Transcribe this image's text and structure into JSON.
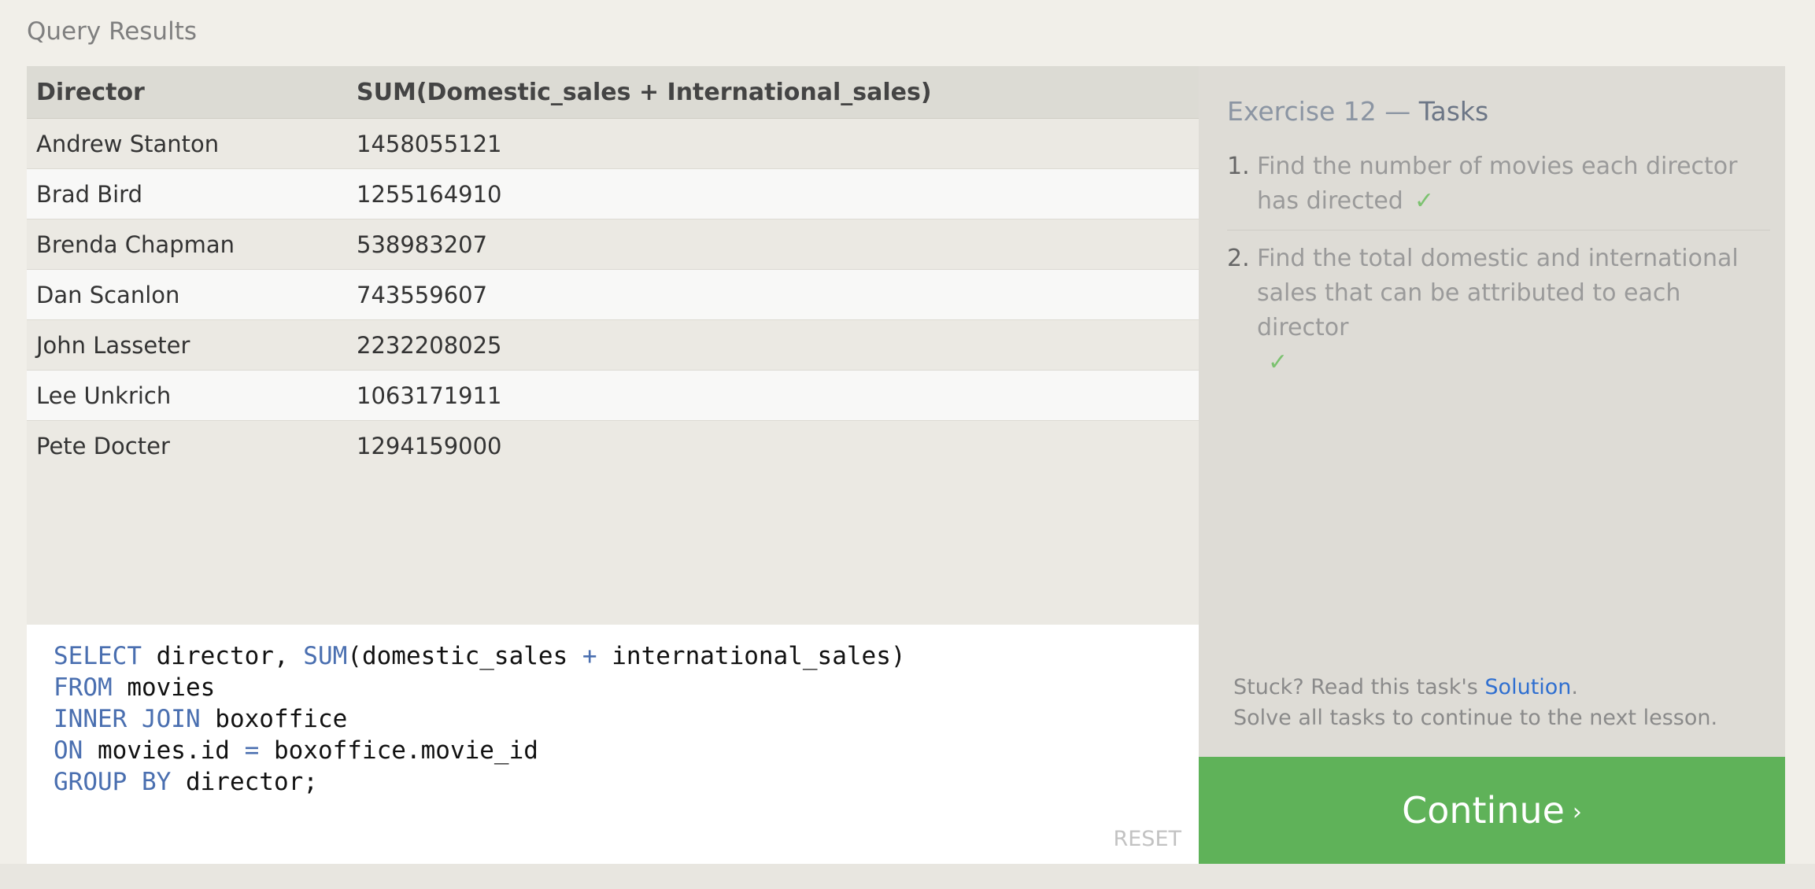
{
  "results": {
    "title": "Query Results",
    "columns": [
      "Director",
      "SUM(Domestic_sales + International_sales)"
    ],
    "rows": [
      [
        "Andrew Stanton",
        "1458055121"
      ],
      [
        "Brad Bird",
        "1255164910"
      ],
      [
        "Brenda Chapman",
        "538983207"
      ],
      [
        "Dan Scanlon",
        "743559607"
      ],
      [
        "John Lasseter",
        "2232208025"
      ],
      [
        "Lee Unkrich",
        "1063171911"
      ],
      [
        "Pete Docter",
        "1294159000"
      ]
    ]
  },
  "editor": {
    "lines": [
      [
        "SELECT",
        " director, ",
        "SUM",
        "(domestic_sales ",
        "+",
        " international_sales)"
      ],
      [
        "FROM",
        " movies"
      ],
      [
        "INNER JOIN",
        " boxoffice"
      ],
      [
        "ON",
        " movies.id ",
        "=",
        " boxoffice.movie_id"
      ],
      [
        "GROUP BY",
        " director;"
      ]
    ],
    "reset_label": "RESET"
  },
  "tasks": {
    "title_prefix": "Exercise 12 — ",
    "title_word": "Tasks",
    "items": [
      {
        "num": "1.",
        "text": "Find the number of movies each director has directed",
        "check": "✓"
      },
      {
        "num": "2.",
        "text": "Find the total domestic and international sales that can be attributed to each director",
        "check": "✓"
      }
    ],
    "stuck_prefix": "Stuck? Read this task's ",
    "stuck_link": "Solution",
    "stuck_suffix": ".",
    "solve_note": "Solve all tasks to continue to the next lesson.",
    "continue_label": "Continue",
    "continue_chevron": "›"
  },
  "colors": {
    "continue_bg": "#5fb259",
    "keyword": "#4a6fb0",
    "link": "#2f6fd0",
    "check": "#7cc270"
  }
}
